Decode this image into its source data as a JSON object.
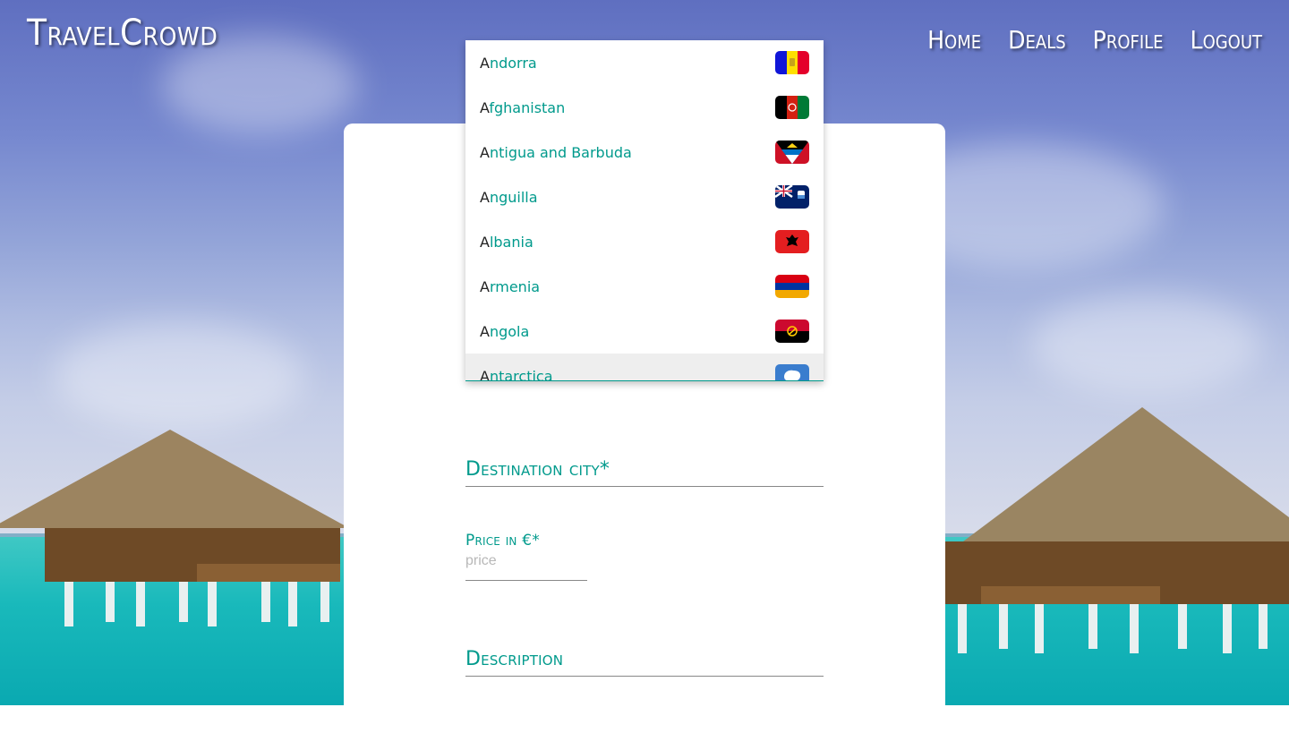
{
  "header": {
    "logo": "TravelCrowd",
    "nav": [
      "Home",
      "Deals",
      "Profile",
      "Logout"
    ]
  },
  "form": {
    "destination_city_label": "Destination city*",
    "price_label": "Price in €*",
    "price_placeholder": "price",
    "description_label": "Description"
  },
  "country_dropdown": {
    "options": [
      {
        "first": "A",
        "rest": "ndorra",
        "flag": "andorra-flag"
      },
      {
        "first": "A",
        "rest": "fghanistan",
        "flag": "afghanistan-flag"
      },
      {
        "first": "A",
        "rest": "ntigua and Barbuda",
        "flag": "antigua-and-barbuda-flag"
      },
      {
        "first": "A",
        "rest": "nguilla",
        "flag": "anguilla-flag"
      },
      {
        "first": "A",
        "rest": "lbania",
        "flag": "albania-flag"
      },
      {
        "first": "A",
        "rest": "rmenia",
        "flag": "armenia-flag"
      },
      {
        "first": "A",
        "rest": "ngola",
        "flag": "angola-flag"
      },
      {
        "first": "A",
        "rest": "ntarctica",
        "flag": "antarctica-flag"
      }
    ],
    "highlighted_option": "Antarctica"
  },
  "colors": {
    "accent": "#009a8c",
    "card": "#ffffff",
    "highlight": "#eeeeee"
  }
}
